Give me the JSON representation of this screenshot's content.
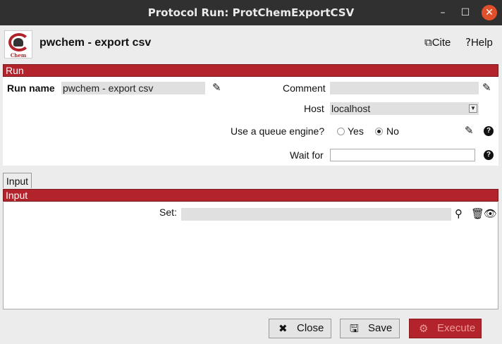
{
  "window": {
    "title": "Protocol Run: ProtChemExportCSV",
    "min_icon": "minimize-icon",
    "max_icon": "maximize-icon",
    "close_icon": "close-icon"
  },
  "header": {
    "logo_text": "Chem",
    "title": "pwchem - export csv",
    "cite_label": "Cite",
    "help_label": "Help"
  },
  "run": {
    "section_label": "Run",
    "run_name_label": "Run name",
    "run_name_value": "pwchem - export csv",
    "comment_label": "Comment",
    "comment_value": "",
    "host_label": "Host",
    "host_value": "localhost",
    "queue_label": "Use a queue engine?",
    "queue_yes": "Yes",
    "queue_no": "No",
    "queue_selected": "No",
    "wait_label": "Wait for",
    "wait_value": ""
  },
  "input": {
    "tab_label": "Input",
    "section_label": "Input",
    "set_label": "Set:",
    "set_value": ""
  },
  "footer": {
    "close_label": "Close",
    "save_label": "Save",
    "execute_label": "Execute"
  },
  "colors": {
    "accent": "#b3232b",
    "titlebar": "#303030",
    "window_close": "#e0502a"
  }
}
